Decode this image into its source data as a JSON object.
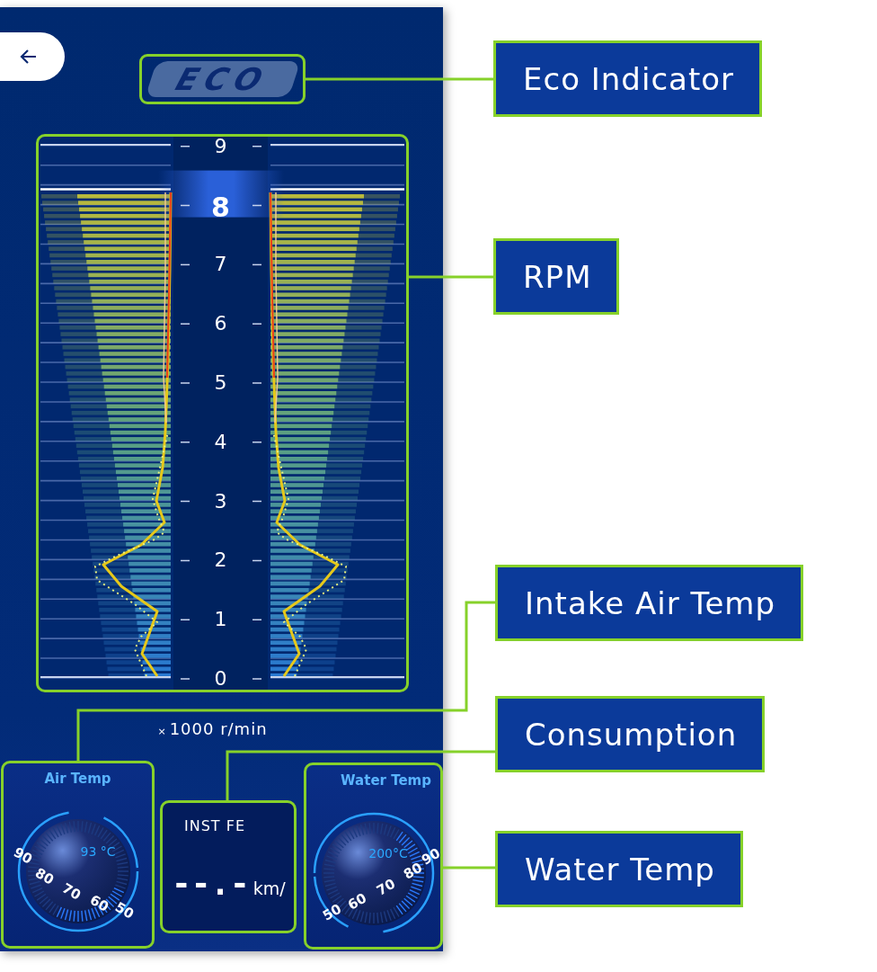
{
  "screen": {
    "eco_indicator": {
      "label": "ECO"
    },
    "rpm": {
      "scale": [
        {
          "label": "9",
          "selected": false
        },
        {
          "label": "8",
          "selected": true
        },
        {
          "label": "7",
          "selected": false
        },
        {
          "label": "6",
          "selected": false
        },
        {
          "label": "5",
          "selected": false
        },
        {
          "label": "4",
          "selected": false
        },
        {
          "label": "3",
          "selected": false
        },
        {
          "label": "2",
          "selected": false
        },
        {
          "label": "1",
          "selected": false
        },
        {
          "label": "0",
          "selected": false
        }
      ],
      "unit_multiplier": "×",
      "unit": "1000 r/min"
    },
    "air_temp": {
      "title": "Air Temp",
      "reading": "93 °C",
      "dial": [
        "90",
        "80",
        "70",
        "60",
        "50"
      ]
    },
    "consumption": {
      "title": "INST FE",
      "value": "--.-",
      "unit": "km/"
    },
    "water_temp": {
      "title": "Water Temp",
      "reading": "200°C",
      "dial": [
        "50",
        "60",
        "70",
        "80",
        "90"
      ]
    }
  },
  "callouts": [
    {
      "label": "Eco Indicator"
    },
    {
      "label": "RPM"
    },
    {
      "label": "Intake Air Temp"
    },
    {
      "label": "Consumption"
    },
    {
      "label": "Water Temp"
    }
  ]
}
